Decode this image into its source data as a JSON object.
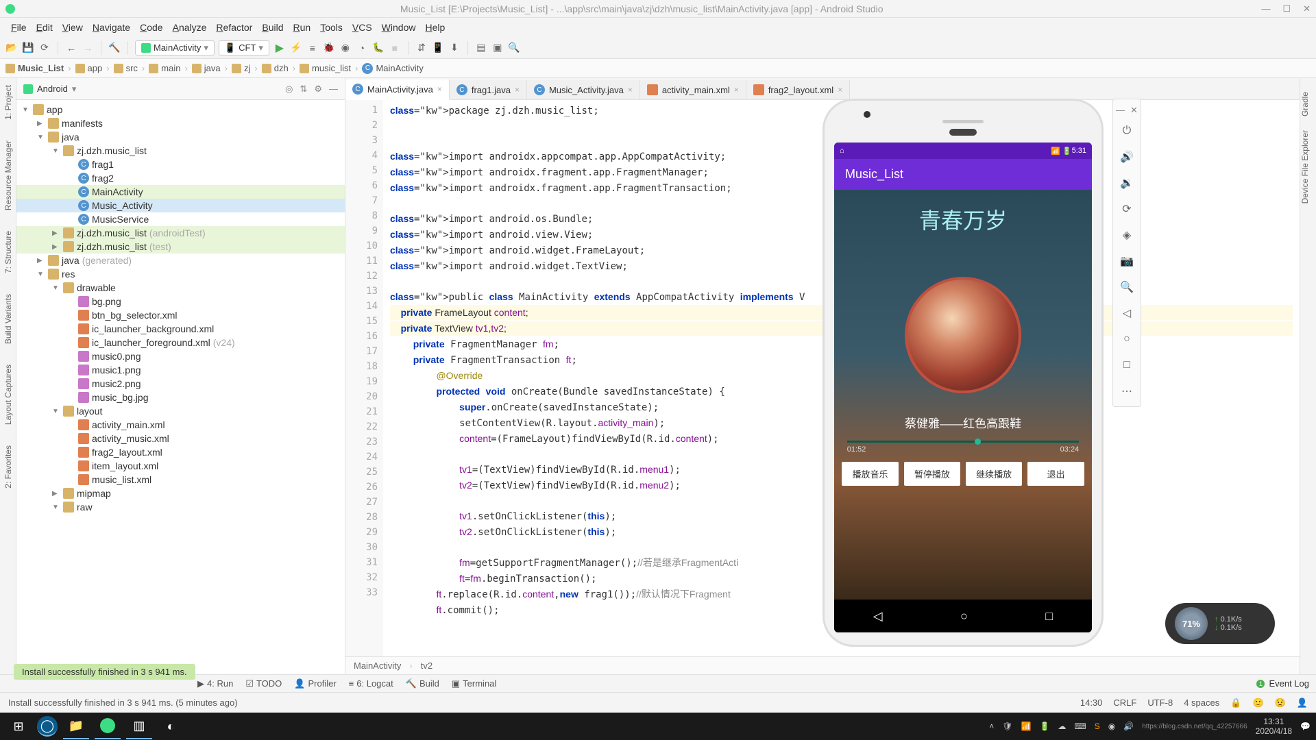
{
  "window": {
    "title": "Music_List [E:\\Projects\\Music_List] - ...\\app\\src\\main\\java\\zj\\dzh\\music_list\\MainActivity.java [app] - Android Studio"
  },
  "menu": [
    "File",
    "Edit",
    "View",
    "Navigate",
    "Code",
    "Analyze",
    "Refactor",
    "Build",
    "Run",
    "Tools",
    "VCS",
    "Window",
    "Help"
  ],
  "toolbar": {
    "config1": "MainActivity",
    "config2": "CFT"
  },
  "breadcrumb": [
    "Music_List",
    "app",
    "src",
    "main",
    "java",
    "zj",
    "dzh",
    "music_list",
    "MainActivity"
  ],
  "panel": {
    "title": "Android",
    "tree": [
      {
        "d": 0,
        "c": "▼",
        "k": "mod",
        "t": "app"
      },
      {
        "d": 1,
        "c": "▶",
        "k": "fld",
        "t": "manifests"
      },
      {
        "d": 1,
        "c": "▼",
        "k": "fld",
        "t": "java"
      },
      {
        "d": 2,
        "c": "▼",
        "k": "pkg",
        "t": "zj.dzh.music_list"
      },
      {
        "d": 3,
        "c": "",
        "k": "cls",
        "t": "frag1"
      },
      {
        "d": 3,
        "c": "",
        "k": "cls",
        "t": "frag2"
      },
      {
        "d": 3,
        "c": "",
        "k": "cls",
        "t": "MainActivity",
        "hl": true
      },
      {
        "d": 3,
        "c": "",
        "k": "cls",
        "t": "Music_Activity",
        "sel": true
      },
      {
        "d": 3,
        "c": "",
        "k": "cls",
        "t": "MusicService"
      },
      {
        "d": 2,
        "c": "▶",
        "k": "pkg",
        "t": "zj.dzh.music_list",
        "suf": "(androidTest)",
        "hl": true
      },
      {
        "d": 2,
        "c": "▶",
        "k": "pkg",
        "t": "zj.dzh.music_list",
        "suf": "(test)",
        "hl": true
      },
      {
        "d": 1,
        "c": "▶",
        "k": "fld",
        "t": "java",
        "suf": "(generated)"
      },
      {
        "d": 1,
        "c": "▼",
        "k": "fld",
        "t": "res"
      },
      {
        "d": 2,
        "c": "▼",
        "k": "fld",
        "t": "drawable"
      },
      {
        "d": 3,
        "c": "",
        "k": "png",
        "t": "bg.png"
      },
      {
        "d": 3,
        "c": "",
        "k": "xml",
        "t": "btn_bg_selector.xml"
      },
      {
        "d": 3,
        "c": "",
        "k": "xml",
        "t": "ic_launcher_background.xml"
      },
      {
        "d": 3,
        "c": "",
        "k": "xml",
        "t": "ic_launcher_foreground.xml",
        "suf": "(v24)"
      },
      {
        "d": 3,
        "c": "",
        "k": "png",
        "t": "music0.png"
      },
      {
        "d": 3,
        "c": "",
        "k": "png",
        "t": "music1.png"
      },
      {
        "d": 3,
        "c": "",
        "k": "png",
        "t": "music2.png"
      },
      {
        "d": 3,
        "c": "",
        "k": "png",
        "t": "music_bg.jpg"
      },
      {
        "d": 2,
        "c": "▼",
        "k": "fld",
        "t": "layout"
      },
      {
        "d": 3,
        "c": "",
        "k": "xml",
        "t": "activity_main.xml"
      },
      {
        "d": 3,
        "c": "",
        "k": "xml",
        "t": "activity_music.xml"
      },
      {
        "d": 3,
        "c": "",
        "k": "xml",
        "t": "frag2_layout.xml"
      },
      {
        "d": 3,
        "c": "",
        "k": "xml",
        "t": "item_layout.xml"
      },
      {
        "d": 3,
        "c": "",
        "k": "xml",
        "t": "music_list.xml"
      },
      {
        "d": 2,
        "c": "▶",
        "k": "fld",
        "t": "mipmap"
      },
      {
        "d": 2,
        "c": "▼",
        "k": "fld",
        "t": "raw"
      }
    ]
  },
  "tabs": [
    {
      "label": "MainActivity.java",
      "icon": "cls",
      "active": true
    },
    {
      "label": "frag1.java",
      "icon": "cls"
    },
    {
      "label": "Music_Activity.java",
      "icon": "cls"
    },
    {
      "label": "activity_main.xml",
      "icon": "xml"
    },
    {
      "label": "frag2_layout.xml",
      "icon": "xml"
    }
  ],
  "code": {
    "lines": [
      "package zj.dzh.music_list;",
      "",
      "",
      "import androidx.appcompat.app.AppCompatActivity;",
      "import androidx.fragment.app.FragmentManager;",
      "import androidx.fragment.app.FragmentTransaction;",
      "",
      "import android.os.Bundle;",
      "import android.view.View;",
      "import android.widget.FrameLayout;",
      "import android.widget.TextView;",
      "",
      "public class MainActivity extends AppCompatActivity implements V",
      "    private FrameLayout content;",
      "    private TextView tv1,tv2;",
      "    private FragmentManager fm;",
      "    private FragmentTransaction ft;",
      "        @Override",
      "        protected void onCreate(Bundle savedInstanceState) {",
      "            super.onCreate(savedInstanceState);",
      "            setContentView(R.layout.activity_main);",
      "            content=(FrameLayout)findViewById(R.id.content);",
      "",
      "            tv1=(TextView)findViewById(R.id.menu1);",
      "            tv2=(TextView)findViewById(R.id.menu2);",
      "",
      "            tv1.setOnClickListener(this);",
      "            tv2.setOnClickListener(this);",
      "",
      "            fm=getSupportFragmentManager();//若是继承FragmentActi",
      "            ft=fm.beginTransaction();",
      "        ft.replace(R.id.content,new frag1());//默认情况下Fragment",
      "        ft.commit();"
    ],
    "bottom_bc": [
      "MainActivity",
      "tv2"
    ]
  },
  "rails": {
    "left": [
      "1: Project",
      "Resource Manager",
      "7: Structure",
      "Build Variants",
      "Layout Captures",
      "2: Favorites"
    ],
    "right": [
      "Gradle",
      "Device File Explorer"
    ]
  },
  "bottom_tools": [
    {
      "icon": "▶",
      "label": "4: Run"
    },
    {
      "icon": "☑",
      "label": "TODO"
    },
    {
      "icon": "👤",
      "label": "Profiler"
    },
    {
      "icon": "≡",
      "label": "6: Logcat"
    },
    {
      "icon": "🔨",
      "label": "Build"
    },
    {
      "icon": "▣",
      "label": "Terminal"
    }
  ],
  "event_log_label": "Event Log",
  "install_msg": "Install successfully finished in 3 s 941 ms.",
  "statusbar": {
    "left": "Install successfully finished in 3 s 941 ms. (5 minutes ago)",
    "right": [
      "14:30",
      "CRLF",
      "UTF-8",
      "4 spaces"
    ]
  },
  "emulator": {
    "status_time": "5:31",
    "app_title": "Music_List",
    "doodle": "青春万岁",
    "song": "蔡健雅——红色高跟鞋",
    "time_cur": "01:52",
    "time_tot": "03:24",
    "buttons": [
      "播放音乐",
      "暂停播放",
      "继续播放",
      "退出"
    ],
    "tools": [
      "⏻",
      "🔊",
      "🔉",
      "⟳",
      "◈",
      "📷",
      "🔍",
      "◁",
      "○",
      "□",
      "⋯"
    ],
    "tool_header": [
      "—",
      "✕"
    ]
  },
  "netwidget": {
    "pct": "71%",
    "up": "0.1K/s",
    "down": "0.1K/s"
  },
  "taskbar": {
    "time": "13:31",
    "date": "2020/4/18",
    "watermark": "https://blog.csdn.net/qq_42257666"
  }
}
